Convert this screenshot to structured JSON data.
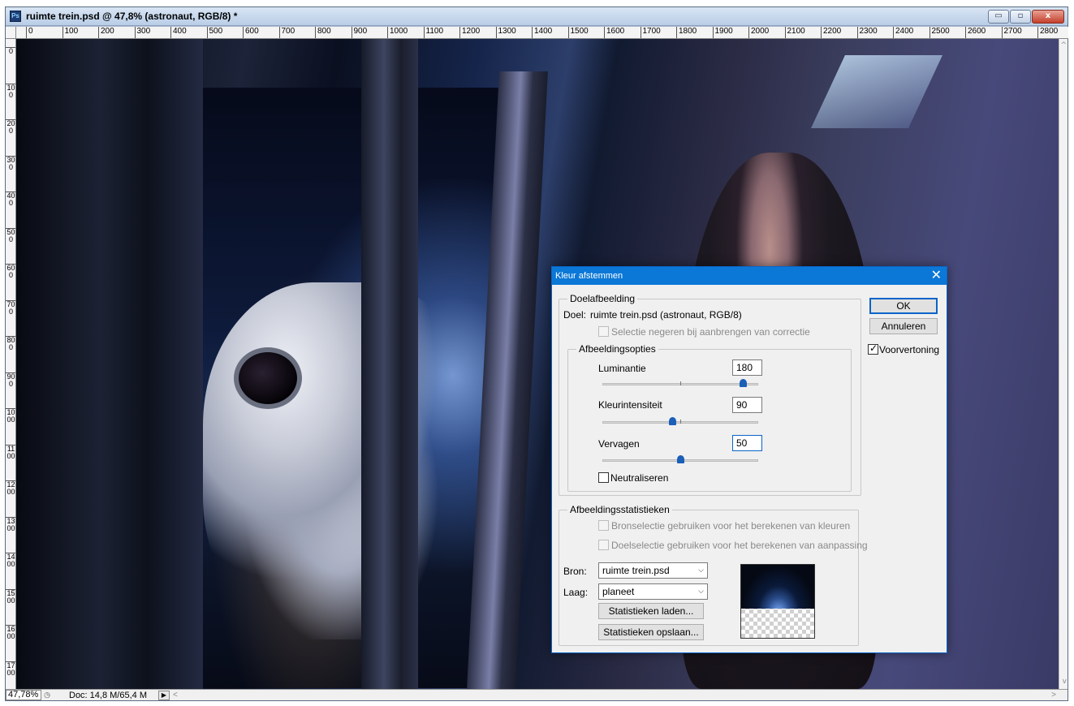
{
  "window": {
    "icon_label": "Ps",
    "title": "ruimte trein.psd @ 47,8% (astronaut, RGB/8) *",
    "controls": {
      "minimize": "▭",
      "maximize": "▫",
      "close": "x"
    }
  },
  "ruler_h": [
    "0",
    "100",
    "200",
    "300",
    "400",
    "500",
    "600",
    "700",
    "800",
    "900",
    "1000",
    "1100",
    "1200",
    "1300",
    "1400",
    "1500",
    "1600",
    "1700",
    "1800",
    "1900",
    "2000",
    "2100",
    "2200",
    "2300",
    "2400",
    "2500",
    "2600",
    "2700",
    "2800"
  ],
  "ruler_v": [
    "0",
    "100",
    "200",
    "300",
    "400",
    "500",
    "600",
    "700",
    "800",
    "900",
    "1000",
    "1100",
    "1200",
    "1300",
    "1400",
    "1500",
    "1600",
    "1700"
  ],
  "status": {
    "zoom": "47,78%",
    "doc_size": "Doc: 14,8 M/65,4 M",
    "arrow": "▶",
    "scroll_left": "<",
    "scroll_right": ">",
    "scroll_up": "^",
    "scroll_down": "v"
  },
  "dialog": {
    "title": "Kleur afstemmen",
    "close": "✕",
    "target_group": {
      "legend": "Doelafbeelding",
      "target_label": "Doel:",
      "target_value": "ruimte trein.psd (astronaut, RGB/8)",
      "ignore_selection": {
        "label": "Selectie negeren bij aanbrengen van correctie",
        "checked": false,
        "enabled": false
      }
    },
    "image_options": {
      "legend": "Afbeeldingsopties",
      "luminance": {
        "label": "Luminantie",
        "value": "180",
        "slider_fraction": 0.9
      },
      "intensity": {
        "label": "Kleurintensiteit",
        "value": "90",
        "slider_fraction": 0.45
      },
      "fade": {
        "label": "Vervagen",
        "value": "50",
        "slider_fraction": 0.5
      },
      "neutralize": {
        "label": "Neutraliseren",
        "checked": false
      }
    },
    "statistics": {
      "legend": "Afbeeldingsstatistieken",
      "use_source_selection": {
        "label": "Bronselectie gebruiken voor het berekenen van kleuren",
        "checked": false,
        "enabled": false
      },
      "use_target_selection": {
        "label": "Doelselectie gebruiken voor het berekenen van aanpassing",
        "checked": false,
        "enabled": false
      },
      "source_label": "Bron:",
      "source_value": "ruimte trein.psd",
      "layer_label": "Laag:",
      "layer_value": "planeet",
      "load_button": "Statistieken laden...",
      "save_button": "Statistieken opslaan..."
    },
    "buttons": {
      "ok": "OK",
      "cancel": "Annuleren"
    },
    "preview": {
      "label": "Voorvertoning",
      "checked": true
    }
  },
  "colors": {
    "dialog_titlebar": "#0b78d7",
    "slider_thumb": "#1a5fb8",
    "focus_border": "#0a64c8"
  }
}
